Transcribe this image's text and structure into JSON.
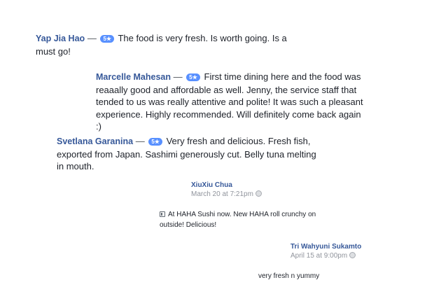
{
  "reviews": [
    {
      "reviewer": "Yap Jia Hao",
      "separator": "—",
      "rating": "5★",
      "text": "The food is very fresh. Is worth going. Is a must go!"
    },
    {
      "reviewer": "Marcelle Mahesan",
      "separator": "—",
      "rating": "5★",
      "text": "First time dining here and the food was reaaally good and affordable as well. Jenny, the service staff that tended to us was really attentive and polite! It was such a pleasant experience. Highly recommended. Will definitely come back again :)"
    },
    {
      "reviewer": "Svetlana Garanina",
      "separator": "—",
      "rating": "5★",
      "text": "Very fresh and delicious. Fresh fish, exported from Japan. Sashimi generously cut. Belly tuna melting in mouth."
    }
  ],
  "posts": [
    {
      "name": "XiuXiu Chua",
      "time": "March 20 at 7:21pm",
      "text": "At HAHA Sushi now. New HAHA roll crunchy on outside! Delicious!"
    },
    {
      "name": "Tri Wahyuni Sukamto",
      "time": "April 15 at 9:00pm",
      "text": "very fresh n yummy"
    }
  ],
  "colors": {
    "name_link": "#365899",
    "rating_badge": "#5890ff",
    "body_text": "#1d2129",
    "meta_text": "#90949c"
  },
  "icons": {
    "audience": "globe-icon",
    "place": "place-icon",
    "rating": "star"
  }
}
